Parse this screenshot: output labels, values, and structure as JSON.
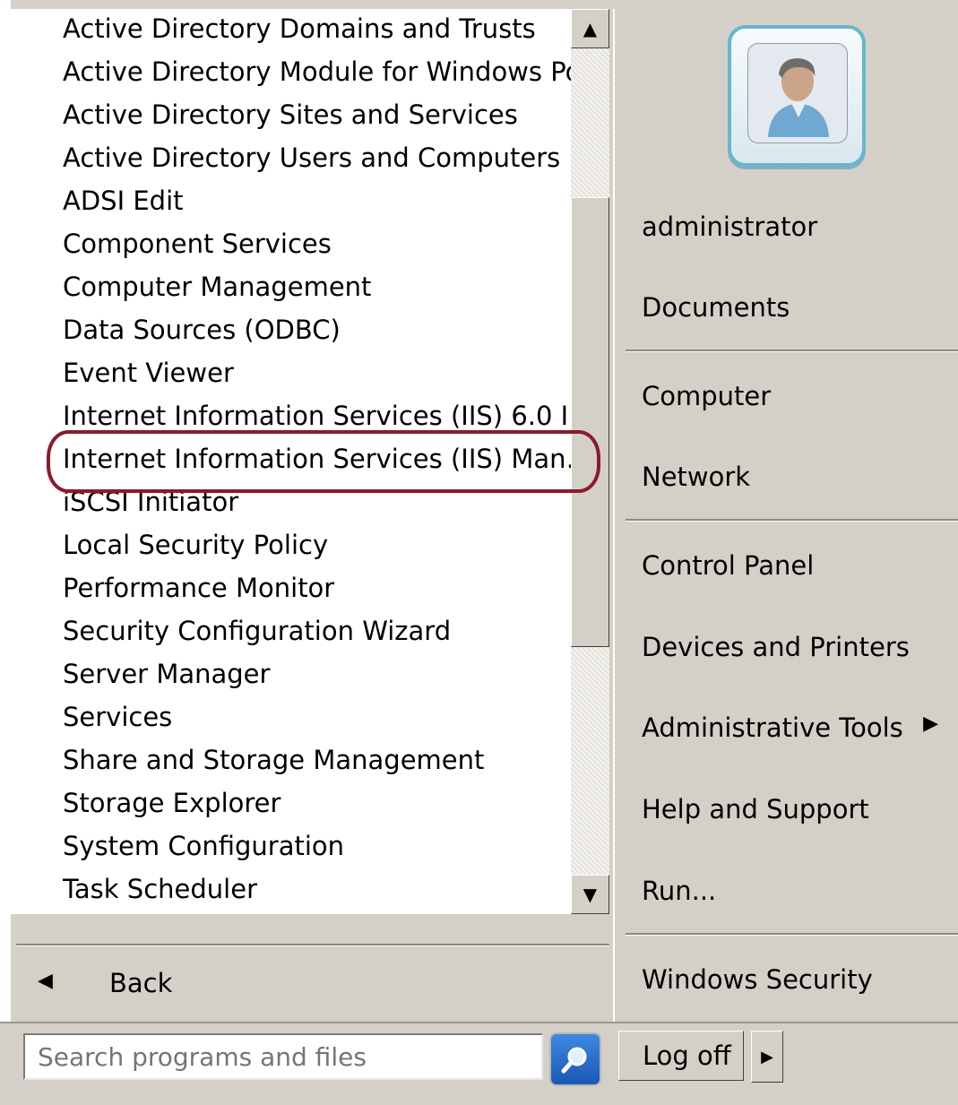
{
  "programs": [
    {
      "label": "Active Directory Domains and Trusts",
      "icon": "ad-domains-trusts-icon",
      "color": "#c9a24b"
    },
    {
      "label": "Active Directory Module for Windows Po",
      "icon": "powershell-icon",
      "color": "#2b63b5"
    },
    {
      "label": "Active Directory Sites and Services",
      "icon": "ad-sites-icon",
      "color": "#3a6fc9"
    },
    {
      "label": "Active Directory Users and Computers",
      "icon": "ad-users-icon",
      "color": "#e2c05a"
    },
    {
      "label": "ADSI Edit",
      "icon": "adsi-edit-icon",
      "color": "#b89a4d"
    },
    {
      "label": "Component Services",
      "icon": "component-services-icon",
      "color": "#d6b24a"
    },
    {
      "label": "Computer Management",
      "icon": "computer-management-icon",
      "color": "#4d79b6"
    },
    {
      "label": "Data Sources (ODBC)",
      "icon": "odbc-icon",
      "color": "#6d7b8a"
    },
    {
      "label": "Event Viewer",
      "icon": "event-viewer-icon",
      "color": "#c07a2e"
    },
    {
      "label": "Internet Information Services (IIS) 6.0 I",
      "icon": "iis6-icon",
      "color": "#3c84c8"
    },
    {
      "label": "Internet Information Services (IIS) Man…",
      "icon": "iis-manager-icon",
      "color": "#3c84c8"
    },
    {
      "label": "iSCSI Initiator",
      "icon": "iscsi-icon",
      "color": "#3d8bc4"
    },
    {
      "label": "Local Security Policy",
      "icon": "local-security-policy-icon",
      "color": "#b8892c"
    },
    {
      "label": "Performance Monitor",
      "icon": "performance-monitor-icon",
      "color": "#c0392b"
    },
    {
      "label": "Security Configuration Wizard",
      "icon": "security-wizard-icon",
      "color": "#b8892c"
    },
    {
      "label": "Server Manager",
      "icon": "server-manager-icon",
      "color": "#6f7c89"
    },
    {
      "label": "Services",
      "icon": "services-gear-icon",
      "color": "#8aa4bf"
    },
    {
      "label": "Share and Storage Management",
      "icon": "share-storage-icon",
      "color": "#c49a42"
    },
    {
      "label": "Storage Explorer",
      "icon": "storage-explorer-icon",
      "color": "#5a7ea6"
    },
    {
      "label": "System Configuration",
      "icon": "system-configuration-icon",
      "color": "#2f6fbf"
    },
    {
      "label": "Task Scheduler",
      "icon": "task-scheduler-icon",
      "color": "#b0b0b0"
    }
  ],
  "highlighted_program": "Internet Information Services (IIS) Man…",
  "back_label": "Back",
  "search": {
    "placeholder": "Search programs and files",
    "value": "Search programs and files"
  },
  "right_panel": {
    "user": "administrator",
    "items": [
      "Documents",
      "Computer",
      "Network",
      "Control Panel",
      "Devices and Printers",
      "Administrative Tools",
      "Help and Support",
      "Run...",
      "Windows Security"
    ]
  },
  "logoff_label": "Log off",
  "colors": {
    "highlight_ellipse": "#8b1a2b",
    "menu_background": "#d4d0c8"
  }
}
